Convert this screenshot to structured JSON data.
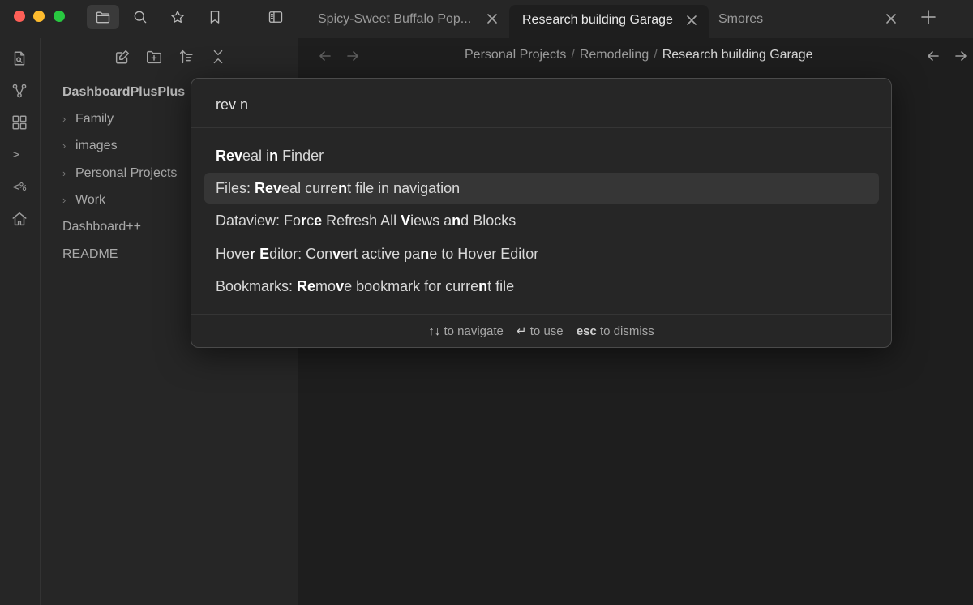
{
  "colors": {
    "window_bg": "#1e1e1e",
    "chrome_bg": "#262626",
    "selected_row": "#363636",
    "traffic_red": "#fe5f57",
    "traffic_yellow": "#febc2e",
    "traffic_green": "#28c840"
  },
  "titlebar": {
    "icons": [
      "folder-icon",
      "search-icon",
      "star-icon",
      "bookmark-icon",
      "sidebar-toggle-icon"
    ],
    "tabs": [
      {
        "label": "Spicy-Sweet Buffalo Pop...",
        "active": false
      },
      {
        "label": "Research building Garage",
        "active": true
      },
      {
        "label": "Smores",
        "active": false
      }
    ],
    "new_tab_icon": "plus-icon"
  },
  "ribbon": {
    "icons": [
      "file-icon",
      "graph-icon",
      "dashboard-icon",
      "terminal-icon",
      "templater-icon",
      "home-icon"
    ],
    "terminal_glyph": ">_",
    "templater_glyph": "<%"
  },
  "file_explorer": {
    "toolbar_icons": [
      "new-note-icon",
      "new-folder-icon",
      "sort-icon",
      "collapse-icon"
    ],
    "root": "DashboardPlusPlus",
    "items": [
      {
        "label": "Family",
        "type": "folder"
      },
      {
        "label": "images",
        "type": "folder"
      },
      {
        "label": "Personal Projects",
        "type": "folder"
      },
      {
        "label": "Work",
        "type": "folder"
      },
      {
        "label": "Dashboard++",
        "type": "file"
      },
      {
        "label": "README",
        "type": "file"
      }
    ]
  },
  "main": {
    "breadcrumb": [
      "Personal Projects",
      "Remodeling",
      "Research building Garage"
    ],
    "separator": "/"
  },
  "command_palette": {
    "query": "rev n",
    "suggestions": [
      {
        "parts": [
          [
            "Rev",
            true
          ],
          [
            "eal ",
            false
          ],
          [
            "i",
            false
          ],
          [
            "n",
            true
          ],
          [
            " Finder",
            false
          ]
        ],
        "selected": false
      },
      {
        "parts": [
          [
            "Files: ",
            false
          ],
          [
            "Rev",
            true
          ],
          [
            "eal curre",
            false
          ],
          [
            "n",
            true
          ],
          [
            "t file in navigation",
            false
          ]
        ],
        "selected": true
      },
      {
        "parts": [
          [
            "Dataview: Fo",
            false
          ],
          [
            "r",
            true
          ],
          [
            "c",
            false
          ],
          [
            "e",
            true
          ],
          [
            " Refresh All ",
            false
          ],
          [
            "V",
            true
          ],
          [
            "iews a",
            false
          ],
          [
            "n",
            true
          ],
          [
            "d Blocks",
            false
          ]
        ],
        "selected": false
      },
      {
        "parts": [
          [
            "Hove",
            false
          ],
          [
            "r",
            true
          ],
          [
            " ",
            false
          ],
          [
            "E",
            true
          ],
          [
            "ditor: Con",
            false
          ],
          [
            "v",
            true
          ],
          [
            "ert active pa",
            false
          ],
          [
            "n",
            true
          ],
          [
            "e to Hover Editor",
            false
          ]
        ],
        "selected": false
      },
      {
        "parts": [
          [
            "Bookmarks: ",
            false
          ],
          [
            "Re",
            true
          ],
          [
            "mo",
            false
          ],
          [
            "v",
            true
          ],
          [
            "e bookmark for curre",
            false
          ],
          [
            "n",
            true
          ],
          [
            "t file",
            false
          ]
        ],
        "selected": false
      }
    ],
    "footer": {
      "navigate_key": "↑↓",
      "navigate_label": "to navigate",
      "use_key": "↵",
      "use_label": "to use",
      "dismiss_key": "esc",
      "dismiss_label": "to dismiss"
    }
  }
}
